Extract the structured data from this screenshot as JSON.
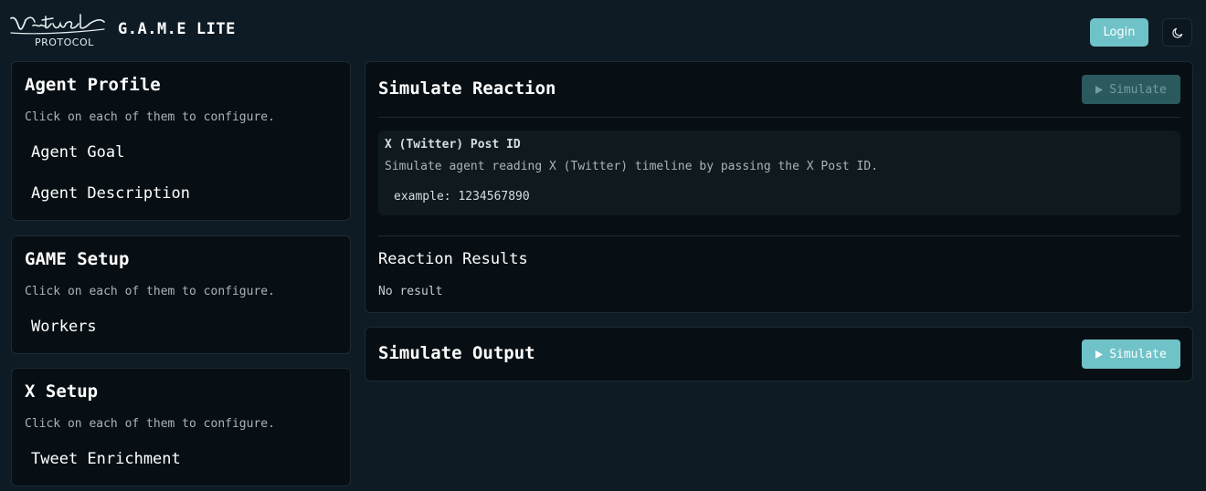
{
  "header": {
    "logo_subtitle": "PROTOCOL",
    "app_title": "G.A.M.E LITE",
    "login_label": "Login"
  },
  "agent_profile": {
    "title": "Agent Profile",
    "hint": "Click on each of them to configure.",
    "items": [
      "Agent Goal",
      "Agent Description"
    ]
  },
  "game_setup": {
    "title": "GAME Setup",
    "hint": "Click on each of them to configure.",
    "items": [
      "Workers"
    ]
  },
  "x_setup": {
    "title": "X Setup",
    "hint": "Click on each of them to configure.",
    "items": [
      "Tweet Enrichment"
    ]
  },
  "simulate_reaction": {
    "title": "Simulate Reaction",
    "button_label": "Simulate",
    "input_label": "X (Twitter) Post ID",
    "input_description": "Simulate agent reading X (Twitter) timeline by passing the X Post ID.",
    "input_placeholder": "example: 1234567890",
    "input_value": "",
    "results_title": "Reaction Results",
    "results_text": "No result"
  },
  "simulate_output": {
    "title": "Simulate Output",
    "button_label": "Simulate"
  },
  "icons": {
    "theme_toggle": "moon-icon",
    "play": "play-icon"
  },
  "colors": {
    "background": "#0e1b24",
    "card": "#070f14",
    "accent": "#6fc3c8",
    "accent_disabled": "#2b5a5e"
  }
}
